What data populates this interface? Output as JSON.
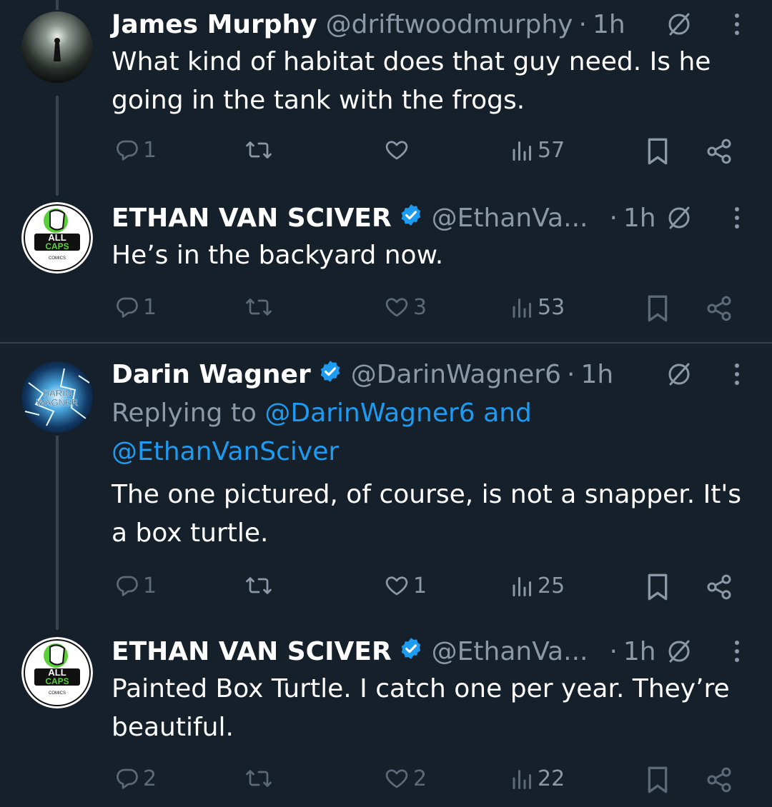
{
  "tweets": [
    {
      "name": "James Murphy",
      "handle": "@driftwoodmurphy",
      "sep": "·",
      "time": "1h",
      "verified": false,
      "text_lines": [
        "What kind of habitat does that guy need. Is he",
        "going in the tank with the frogs."
      ],
      "counts": {
        "reply": "1",
        "retweet": "",
        "like": "",
        "views": "57"
      }
    },
    {
      "name": "ETHAN VAN SCIVER",
      "handle": "@EthanVa...",
      "sep": "·",
      "time": "1h",
      "verified": true,
      "text_lines": [
        "He’s in the backyard now."
      ],
      "counts": {
        "reply": "1",
        "retweet": "",
        "like": "3",
        "views": "53"
      }
    },
    {
      "name": "Darin Wagner",
      "handle": "@DarinWagner6",
      "sep": "·",
      "time": "1h",
      "verified": true,
      "replying_prefix": "Replying to",
      "replying_user1": "@DarinWagner6",
      "replying_and": "and",
      "replying_user2": "@EthanVanSciver",
      "text_lines": [
        "The one pictured, of course, is not a snapper. It's",
        "a box turtle."
      ],
      "counts": {
        "reply": "1",
        "retweet": "",
        "like": "1",
        "views": "25"
      }
    },
    {
      "name": "ETHAN VAN SCIVER",
      "handle": "@EthanVa...",
      "sep": "·",
      "time": "1h",
      "verified": true,
      "text_lines": [
        "Painted Box Turtle.  I catch one per year.  They’re",
        "beautiful."
      ],
      "counts": {
        "reply": "2",
        "retweet": "",
        "like": "2",
        "views": "22"
      }
    }
  ],
  "avatars": {
    "allcaps_line1": "ALL",
    "allcaps_line2": "CAPS",
    "allcaps_line3": "COMICS",
    "darin_line1": "DARIN",
    "darin_line2": "WAGNER"
  },
  "icons": {
    "reply": "reply-icon",
    "retweet": "retweet-icon",
    "like": "heart-icon",
    "views": "views-icon",
    "bookmark": "bookmark-icon",
    "share": "share-icon",
    "grok": "grok-icon",
    "more": "more-icon",
    "verified": "verified-badge-icon"
  },
  "colors": {
    "background": "#15202b",
    "text": "#ffffff",
    "muted": "#8b98a5",
    "link": "#1d9bf0",
    "verified": "#1d9bf0",
    "divider": "#38444d"
  }
}
